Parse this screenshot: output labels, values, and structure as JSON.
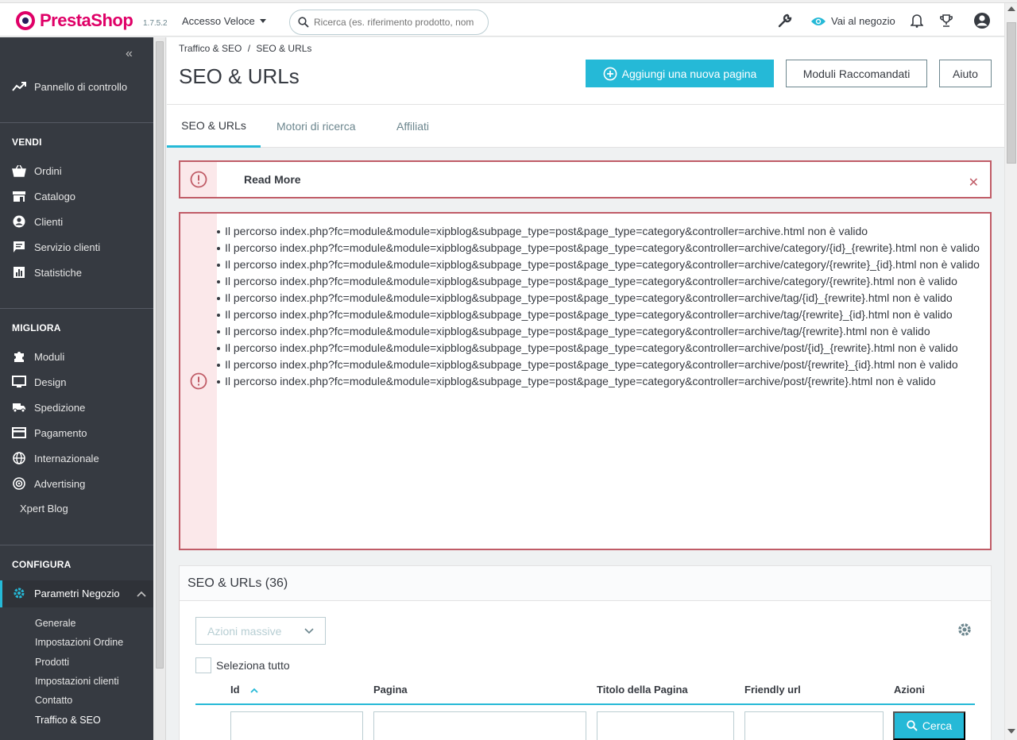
{
  "header": {
    "brand": "PrestaShop",
    "version": "1.7.5.2",
    "quick_access": "Accesso Veloce",
    "search_placeholder": "Ricerca (es. riferimento prodotto, nom",
    "view_store": "Vai al negozio"
  },
  "sidebar": {
    "collapse": "«",
    "dashboard": "Pannello di controllo",
    "sections": {
      "sell": "VENDI",
      "improve": "MIGLIORA",
      "configure": "CONFIGURA"
    },
    "sell_items": [
      "Ordini",
      "Catalogo",
      "Clienti",
      "Servizio clienti",
      "Statistiche"
    ],
    "improve_items": [
      "Moduli",
      "Design",
      "Spedizione",
      "Pagamento",
      "Internazionale",
      "Advertising"
    ],
    "xpert_blog": "Xpert Blog",
    "active_item": "Parametri Negozio",
    "sub_items": [
      "Generale",
      "Impostazioni Ordine",
      "Prodotti",
      "Impostazioni clienti",
      "Contatto",
      "Traffico & SEO"
    ]
  },
  "page": {
    "breadcrumb_parent": "Traffico & SEO",
    "breadcrumb_sep": "/",
    "breadcrumb_current": "SEO & URLs",
    "title": "SEO & URLs",
    "add_button": "Aggiungi una nuova pagina",
    "recommended_button": "Moduli Raccomandati",
    "help_button": "Aiuto",
    "tabs": [
      "SEO & URLs",
      "Motori di ricerca",
      "Affiliati"
    ]
  },
  "alerts": {
    "read_more": "Read More",
    "errors": [
      "Il percorso index.php?fc=module&module=xipblog&subpage_type=post&page_type=category&controller=archive.html non è valido",
      "Il percorso index.php?fc=module&module=xipblog&subpage_type=post&page_type=category&controller=archive/category/{id}_{rewrite}.html non è valido",
      "Il percorso index.php?fc=module&module=xipblog&subpage_type=post&page_type=category&controller=archive/category/{rewrite}_{id}.html non è valido",
      "Il percorso index.php?fc=module&module=xipblog&subpage_type=post&page_type=category&controller=archive/category/{rewrite}.html non è valido",
      "Il percorso index.php?fc=module&module=xipblog&subpage_type=post&page_type=category&controller=archive/tag/{id}_{rewrite}.html non è valido",
      "Il percorso index.php?fc=module&module=xipblog&subpage_type=post&page_type=category&controller=archive/tag/{rewrite}_{id}.html non è valido",
      "Il percorso index.php?fc=module&module=xipblog&subpage_type=post&page_type=category&controller=archive/tag/{rewrite}.html non è valido",
      "Il percorso index.php?fc=module&module=xipblog&subpage_type=post&page_type=category&controller=archive/post/{id}_{rewrite}.html non è valido",
      "Il percorso index.php?fc=module&module=xipblog&subpage_type=post&page_type=category&controller=archive/post/{rewrite}_{id}.html non è valido",
      "Il percorso index.php?fc=module&module=xipblog&subpage_type=post&page_type=category&controller=archive/post/{rewrite}.html non è valido"
    ]
  },
  "panel": {
    "title": "SEO & URLs (36)",
    "bulk_actions": "Azioni massive",
    "select_all": "Seleziona tutto",
    "columns": {
      "id": "Id",
      "page": "Pagina",
      "page_title": "Titolo della Pagina",
      "friendly_url": "Friendly url",
      "actions": "Azioni"
    },
    "search_button": "Cerca"
  },
  "colors": {
    "accent": "#25b9d7",
    "brand": "#df0067",
    "danger": "#c05c67",
    "sidebar": "#363a41"
  }
}
